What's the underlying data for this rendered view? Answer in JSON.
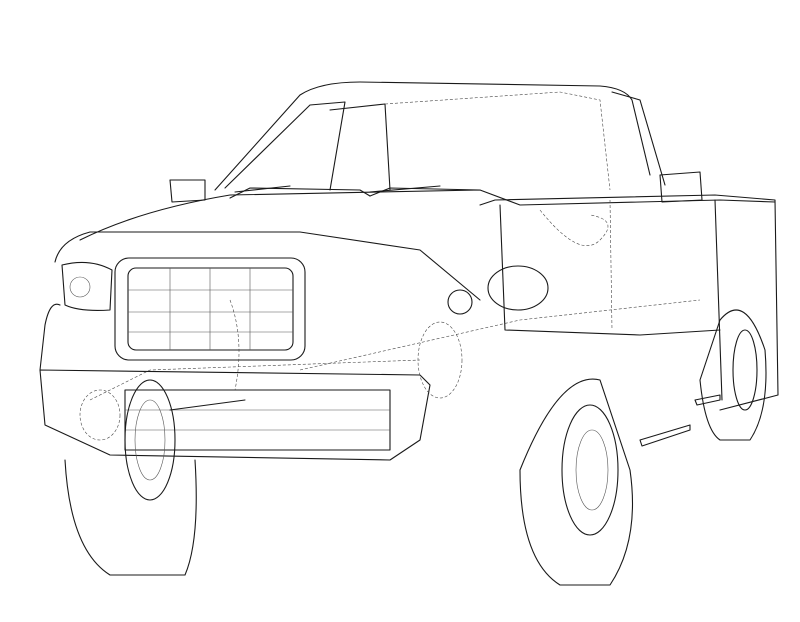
{
  "colors": {
    "stroke": "#1a1a1a",
    "background": "#ffffff"
  }
}
